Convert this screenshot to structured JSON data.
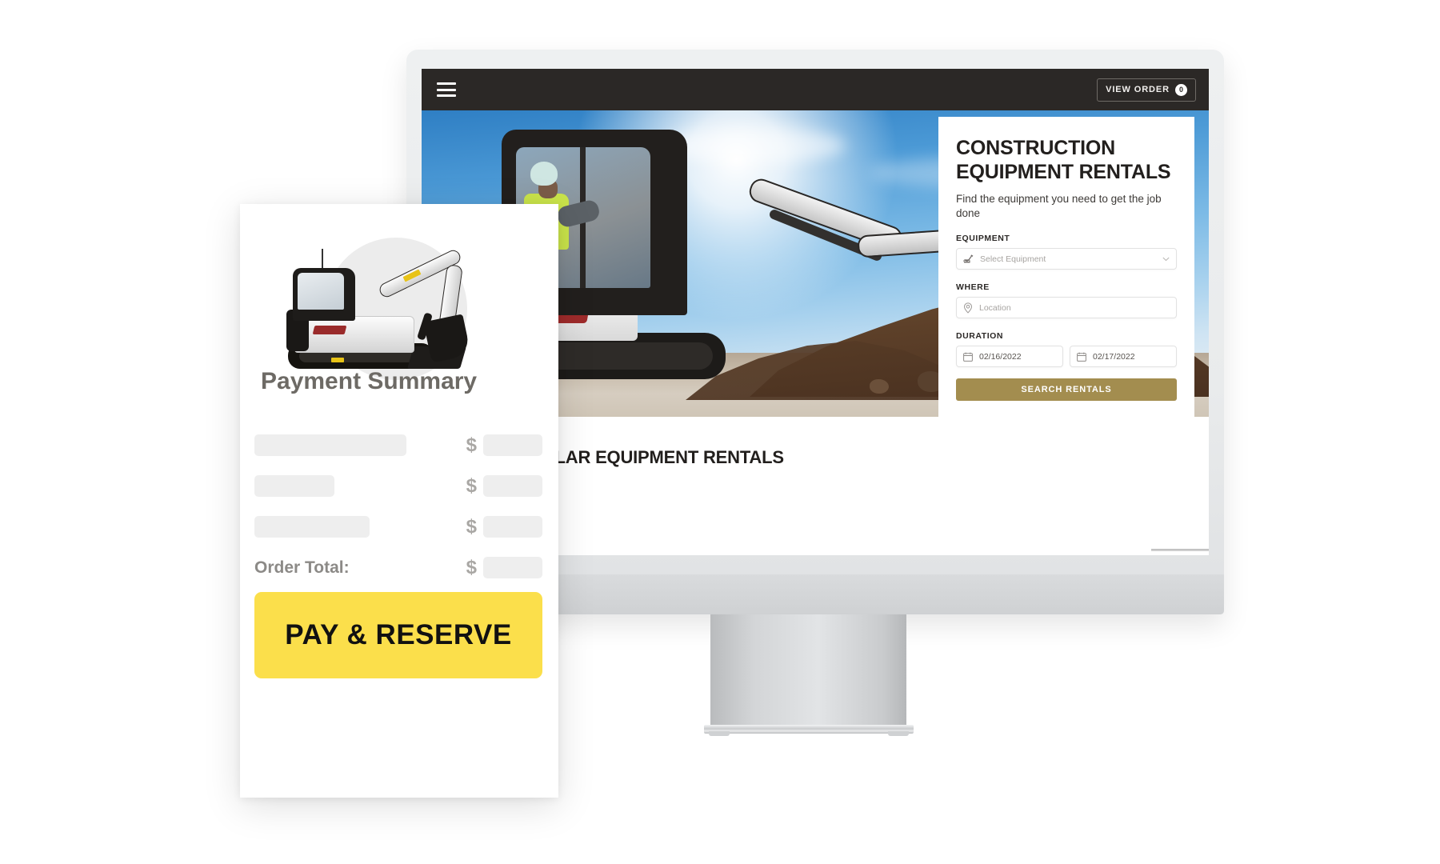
{
  "browser_site": {
    "topbar": {
      "menu_icon": "hamburger-menu-icon",
      "view_order_label": "VIEW ORDER",
      "order_count": "0"
    },
    "hero": {
      "title": "CONSTRUCTION EQUIPMENT RENTALS",
      "subtitle": "Find the equipment you need to get the job done",
      "fields": {
        "equipment_label": "EQUIPMENT",
        "equipment_placeholder": "Select Equipment",
        "equipment_icon": "excavator-icon",
        "where_label": "WHERE",
        "where_placeholder": "Location",
        "where_icon": "map-pin-icon",
        "duration_label": "DURATION",
        "start_date": "02/16/2022",
        "end_date": "02/17/2022",
        "date_icon": "calendar-icon",
        "chevron_icon": "chevron-down-icon"
      },
      "search_button": "SEARCH RENTALS",
      "search_button_color": "#a38d4f"
    },
    "section": {
      "popular_title_full": "POPULAR EQUIPMENT RENTALS",
      "popular_title_visible": "ULAR EQUIPMENT RENTALS"
    }
  },
  "payment_card": {
    "product_image_name": "mini-excavator-product-image",
    "title": "Payment Summary",
    "line_items": [
      {
        "label_placeholder_width": 190,
        "currency": "$",
        "amount_placeholder": ""
      },
      {
        "label_placeholder_width": 100,
        "currency": "$",
        "amount_placeholder": ""
      },
      {
        "label_placeholder_width": 144,
        "currency": "$",
        "amount_placeholder": ""
      }
    ],
    "total_label": "Order Total:",
    "total_currency": "$",
    "pay_button": "PAY & RESERVE",
    "pay_button_color": "#fbdf4b"
  }
}
